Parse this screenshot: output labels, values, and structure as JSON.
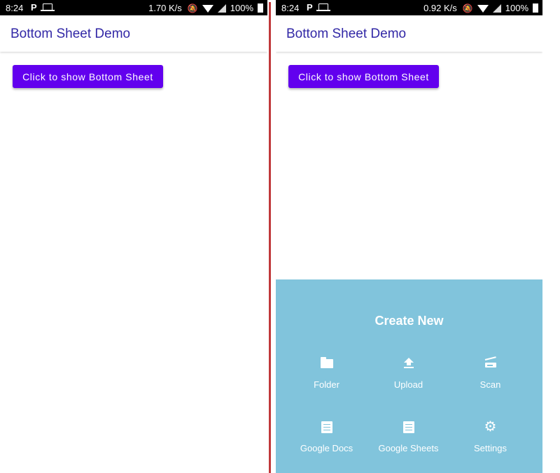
{
  "screens": {
    "left": {
      "status": {
        "time": "8:24",
        "rate": "1.70 K/s",
        "battery": "100%"
      },
      "appbar": {
        "title": "Bottom Sheet Demo"
      },
      "button_label": "Click to show Bottom Sheet"
    },
    "right": {
      "status": {
        "time": "8:24",
        "rate": "0.92 K/s",
        "battery": "100%"
      },
      "appbar": {
        "title": "Bottom Sheet Demo"
      },
      "button_label": "Click to show Bottom Sheet",
      "sheet": {
        "heading": "Create New",
        "items": [
          {
            "label": "Folder",
            "icon": "folder-icon"
          },
          {
            "label": "Upload",
            "icon": "upload-icon"
          },
          {
            "label": "Scan",
            "icon": "scanner-icon"
          },
          {
            "label": "Google Docs",
            "icon": "document-icon"
          },
          {
            "label": "Google Sheets",
            "icon": "document-icon"
          },
          {
            "label": "Settings",
            "icon": "gear-icon"
          }
        ]
      }
    }
  },
  "colors": {
    "primary_button": "#6200ee",
    "title_text": "#3228a6",
    "sheet_background": "#81c4dc",
    "divider": "#c0393b"
  }
}
